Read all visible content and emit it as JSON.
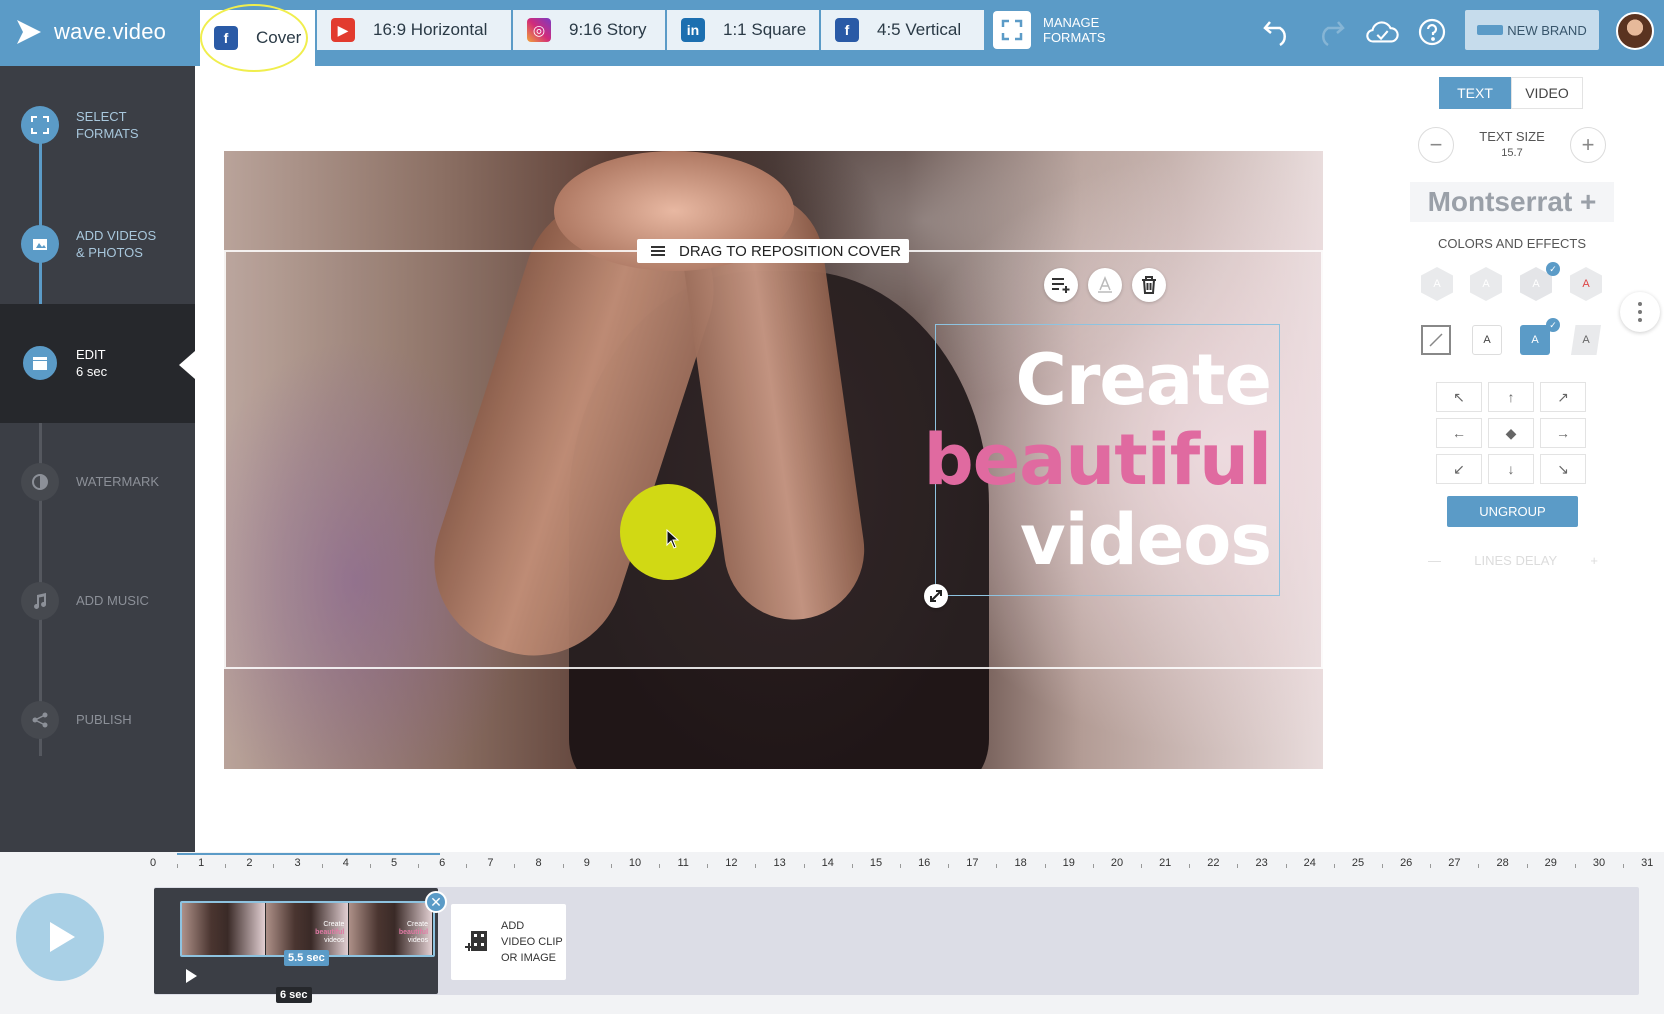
{
  "app": {
    "logo_text": "wave.video"
  },
  "format_tabs": [
    {
      "label": "Cover",
      "icon": "facebook-icon",
      "active": true
    },
    {
      "label": "16:9 Horizontal",
      "icon": "youtube-icon"
    },
    {
      "label": "9:16 Story",
      "icon": "instagram-icon"
    },
    {
      "label": "1:1 Square",
      "icon": "linkedin-icon"
    },
    {
      "label": "4:5 Vertical",
      "icon": "facebook-icon"
    }
  ],
  "manage_formats": {
    "line1": "MANAGE",
    "line2": "FORMATS"
  },
  "toolbar": {
    "new_brand_label": "NEW BRAND"
  },
  "sidebar": {
    "steps": [
      {
        "line1": "SELECT",
        "line2": "FORMATS",
        "state": "done"
      },
      {
        "line1": "ADD VIDEOS",
        "line2": "& PHOTOS",
        "state": "done"
      },
      {
        "line1": "EDIT",
        "line2": "6 sec",
        "state": "active"
      },
      {
        "line1": "WATERMARK",
        "line2": "",
        "state": "inactive"
      },
      {
        "line1": "ADD MUSIC",
        "line2": "",
        "state": "inactive"
      },
      {
        "line1": "PUBLISH",
        "line2": "",
        "state": "inactive"
      }
    ]
  },
  "canvas": {
    "drag_label": "DRAG TO REPOSITION COVER",
    "text_lines": [
      {
        "text": "Create",
        "color": "#ffffff"
      },
      {
        "text": "beautiful",
        "color": "#e06aa0"
      },
      {
        "text": "videos",
        "color": "#ffffff"
      }
    ]
  },
  "right_panel": {
    "tab_text": "TEXT",
    "tab_video": "VIDEO",
    "text_size_label": "TEXT SIZE",
    "text_size_value": "15.7",
    "font_name": "Montserrat +",
    "colors_title": "COLORS AND EFFECTS",
    "swatch_letter": "A",
    "ungroup_label": "UNGROUP",
    "lines_delay_label": "LINES DELAY"
  },
  "timeline": {
    "ticks": [
      "0",
      "1",
      "2",
      "3",
      "4",
      "5",
      "6",
      "7",
      "8",
      "9",
      "10",
      "11",
      "12",
      "13",
      "14",
      "15",
      "16",
      "17",
      "18",
      "19",
      "20",
      "21",
      "22",
      "23",
      "24",
      "25",
      "26",
      "27",
      "28",
      "29",
      "30",
      "31"
    ],
    "clip_duration": "5.5 sec",
    "total_duration": "6 sec",
    "add_clip_label": "ADD\nVIDEO CLIP\nOR IMAGE",
    "thumb_text": {
      "l1": "Create",
      "l2": "beautiful",
      "l3": "videos"
    }
  },
  "colors": {
    "accent": "#5b9bc7",
    "pink": "#e06aa0",
    "sidebar": "#3b3e45",
    "cursor_highlight": "#d1d914"
  }
}
